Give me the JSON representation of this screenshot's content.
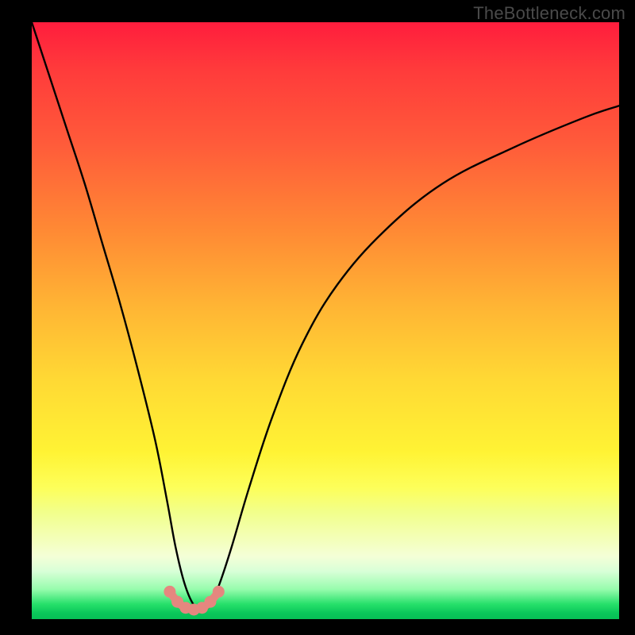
{
  "watermark": "TheBottleneck.com",
  "chart_data": {
    "type": "line",
    "title": "",
    "xlabel": "",
    "ylabel": "",
    "xlim": [
      0,
      100
    ],
    "ylim": [
      0,
      100
    ],
    "series": [
      {
        "name": "bottleneck-curve",
        "x": [
          0,
          3,
          6,
          9,
          12,
          15,
          18,
          21,
          23,
          24.5,
          26,
          27.5,
          29,
          30.5,
          32,
          34,
          37,
          41,
          46,
          52,
          60,
          70,
          82,
          94,
          100
        ],
        "values": [
          100,
          91,
          82,
          73,
          63,
          53,
          42,
          30,
          20,
          12,
          6,
          2.5,
          1.5,
          2.5,
          6,
          12,
          22,
          34,
          46,
          56,
          65,
          73,
          79,
          84,
          86
        ]
      },
      {
        "name": "bottom-highlight",
        "x": [
          23.5,
          24.8,
          26.2,
          27.6,
          29.0,
          30.4,
          31.8
        ],
        "values": [
          4.6,
          2.9,
          1.9,
          1.6,
          1.9,
          2.9,
          4.6
        ]
      }
    ],
    "colors": {
      "curve": "#000000",
      "highlight_stroke": "#e5877f",
      "highlight_dot": "#e5877f"
    }
  }
}
